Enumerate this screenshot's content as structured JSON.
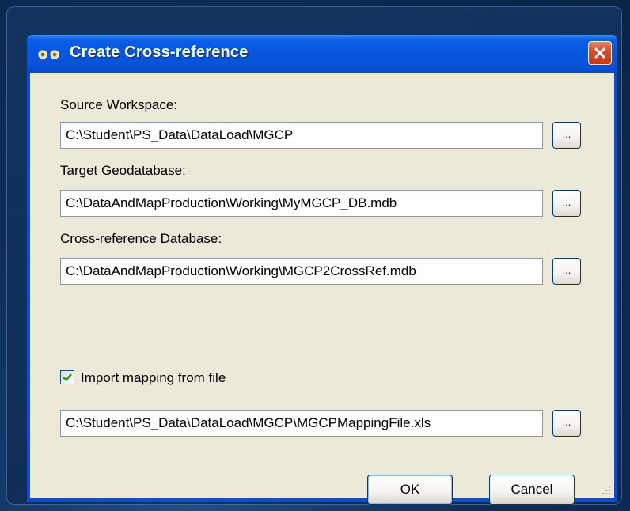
{
  "window": {
    "title": "Create Cross-reference",
    "close_symbol": "✕"
  },
  "source_workspace": {
    "label": "Source Workspace:",
    "value": "C:\\Student\\PS_Data\\DataLoad\\MGCP",
    "browse_label": "..."
  },
  "target_geodatabase": {
    "label": "Target Geodatabase:",
    "value": "C:\\DataAndMapProduction\\Working\\MyMGCP_DB.mdb",
    "browse_label": "..."
  },
  "crossref_database": {
    "label": "Cross-reference Database:",
    "value": "C:\\DataAndMapProduction\\Working\\MGCP2CrossRef.mdb",
    "browse_label": "..."
  },
  "import_mapping": {
    "label": "Import mapping from file",
    "checked": true,
    "value": "C:\\Student\\PS_Data\\DataLoad\\MGCP\\MGCPMappingFile.xls",
    "browse_label": "..."
  },
  "buttons": {
    "ok_label": "OK",
    "cancel_label": "Cancel"
  },
  "icons": {
    "title_icon": "cross-reference-icon",
    "close_icon": "close-icon",
    "check_icon": "checkmark-icon",
    "grip_icon": "resize-grip-icon"
  },
  "colors": {
    "titlebar": "#0855dd",
    "client_background": "#ece9d8",
    "close_button": "#d6502f",
    "checkmark": "#21a121"
  }
}
